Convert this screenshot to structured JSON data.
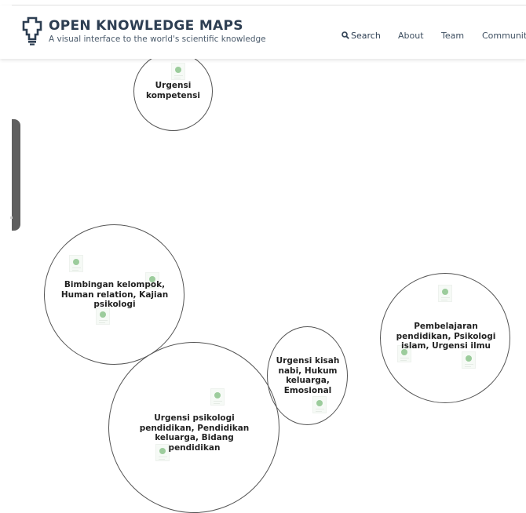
{
  "header": {
    "brand_title": "OPEN KNOWLEDGE MAPS",
    "brand_subtitle": "A visual interface to the world's scientific knowledge",
    "logo_icon": "lightbulb-map-icon",
    "nav": {
      "search_label": "Search",
      "search_icon": "search-icon",
      "about_label": "About",
      "team_label": "Team",
      "community_label": "Community"
    }
  },
  "map": {
    "bubbles": [
      {
        "label": "Urgensi kompetensi"
      },
      {
        "label": "Bimbingan kelompok, Human relation, Kajian psikologi"
      },
      {
        "label": "Urgensi psikologi pendidikan, Pendidikan keluarga, Bidang pendidikan"
      },
      {
        "label": "Urgensi kisah nabi, Hukum keluarga, Emosional"
      },
      {
        "label": "Pembelajaran pendidikan, Psikologi islam, Urgensi ilmu"
      }
    ],
    "paper_icon": "paper-icon"
  },
  "colors": {
    "brand": "#2d3e52",
    "bubble_border": "#555555",
    "paper_dot": "#9ccc9c",
    "sidetab": "#5f5f5f"
  }
}
